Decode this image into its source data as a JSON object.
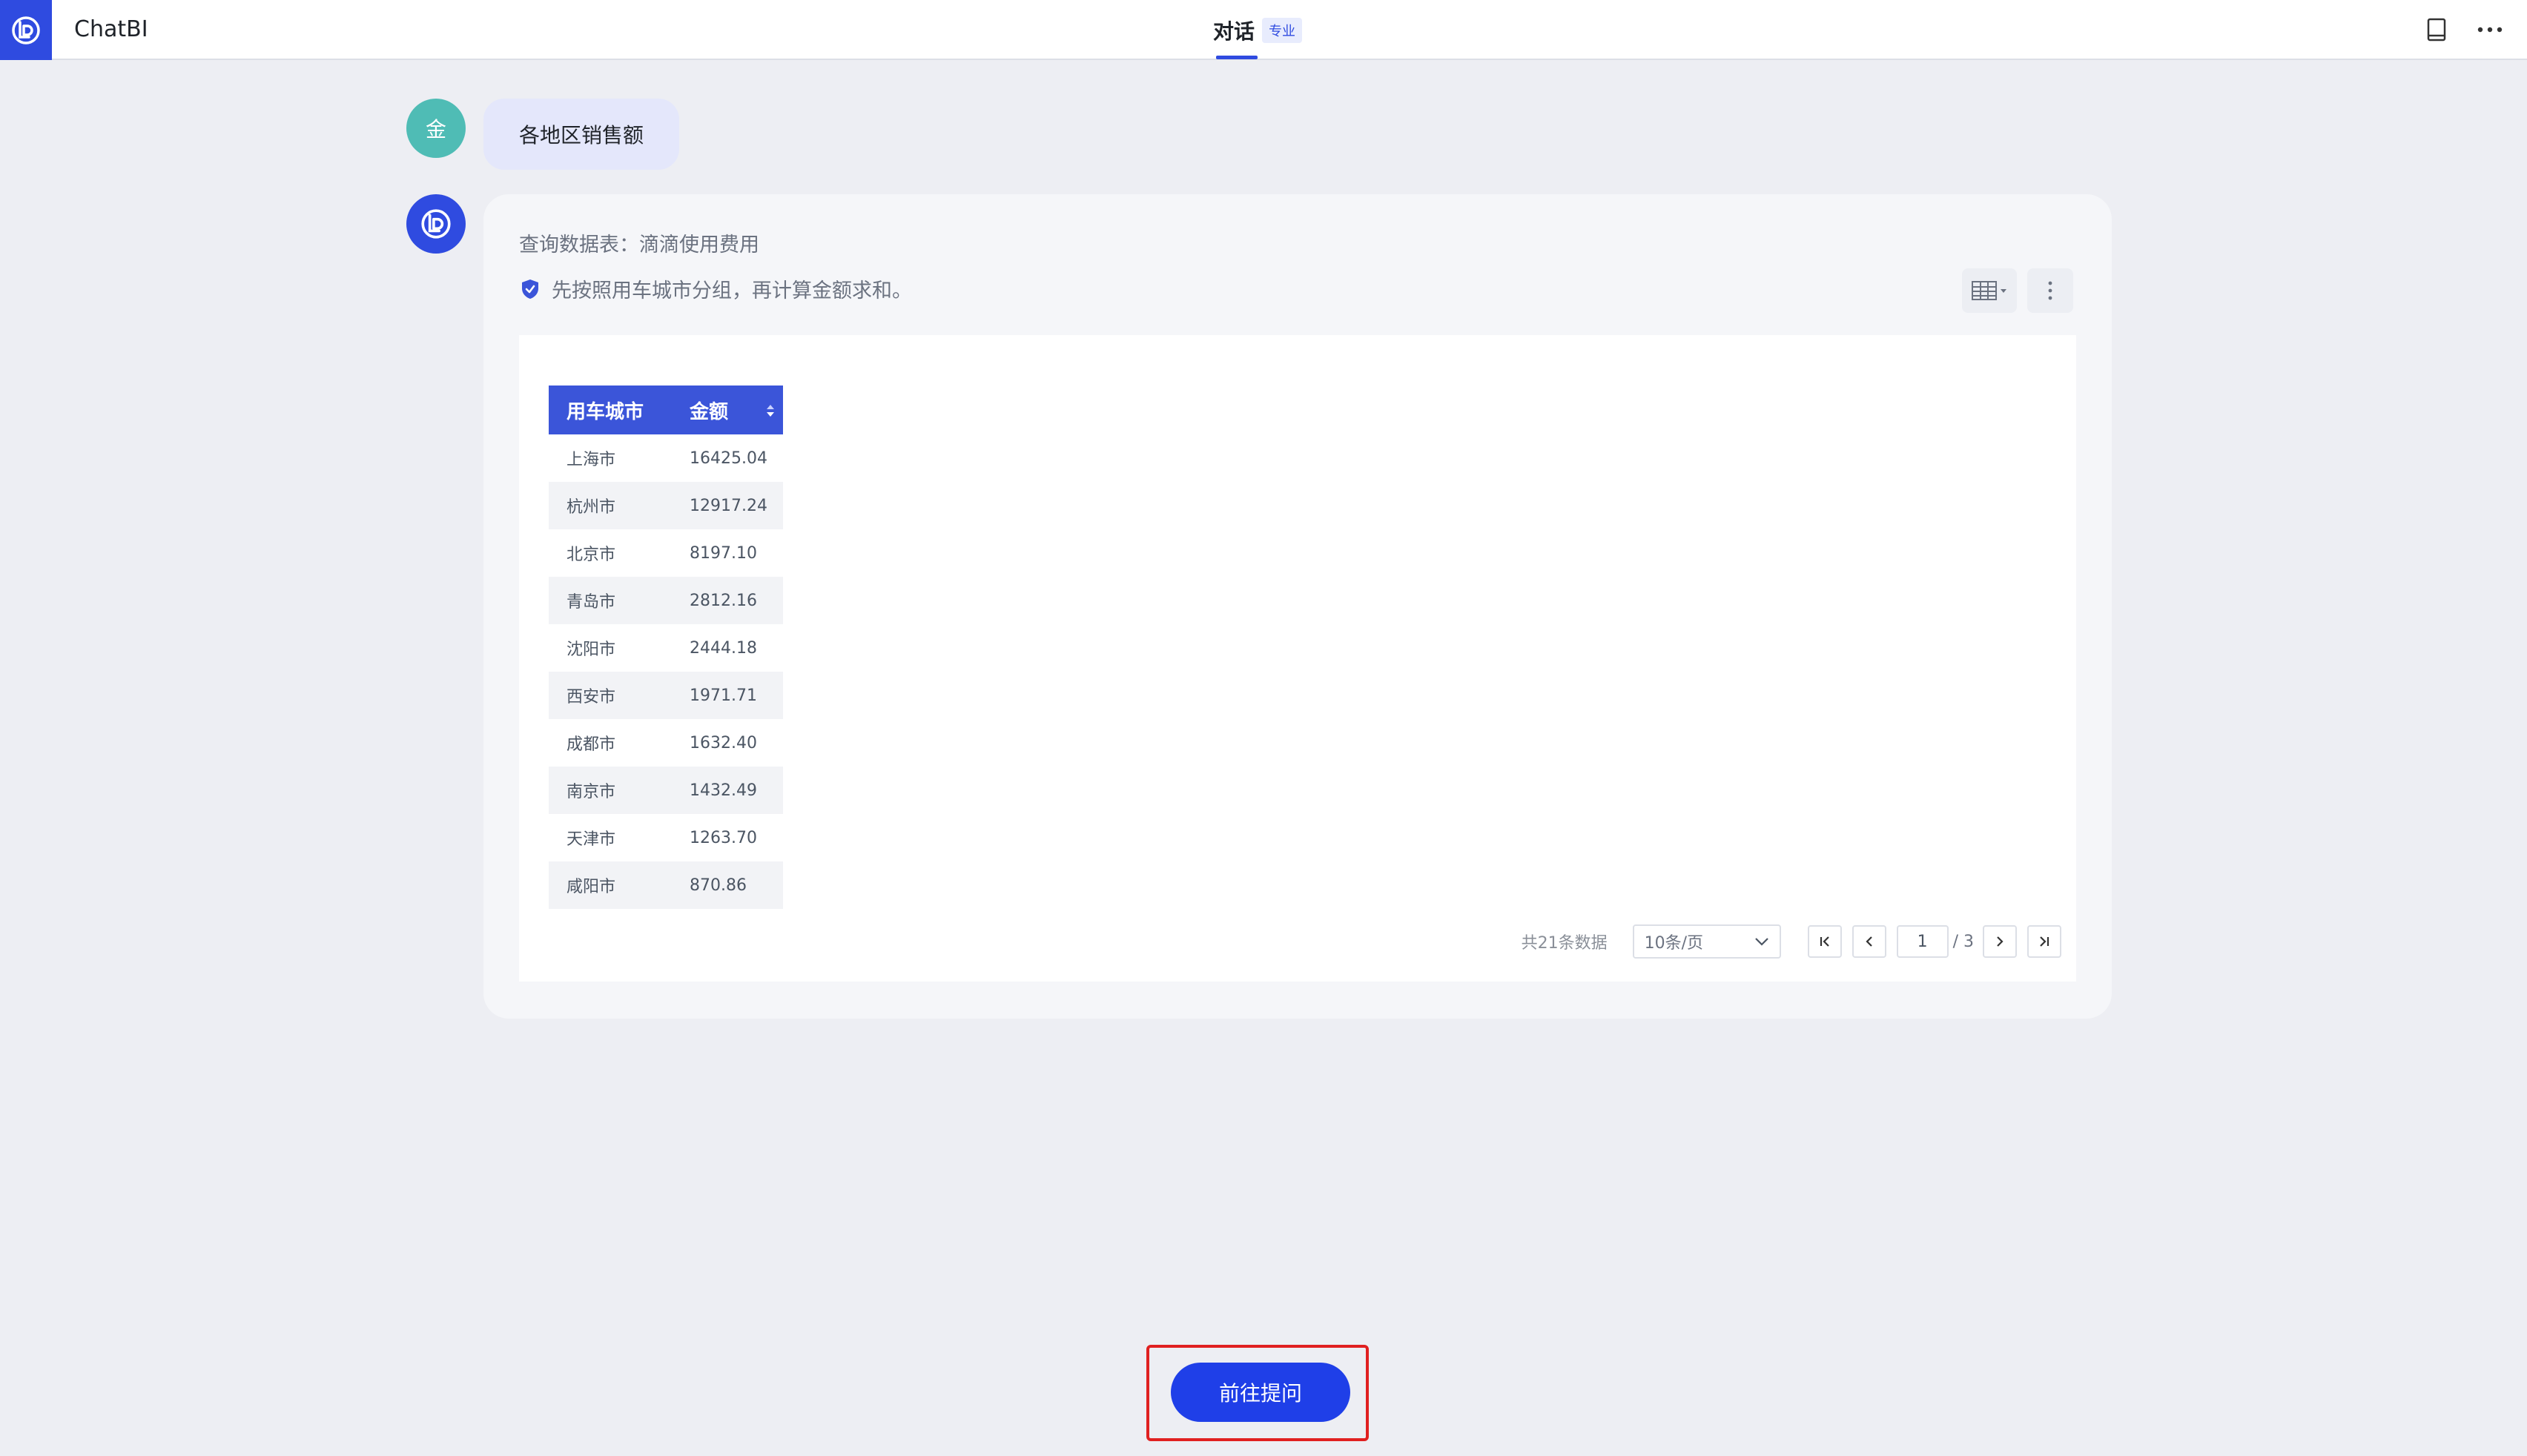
{
  "header": {
    "app_title": "ChatBI",
    "tab_label": "对话",
    "tab_badge": "专业",
    "icons": [
      "app-logo-icon",
      "book-icon",
      "more-horizontal-icon"
    ]
  },
  "conversation": {
    "user_avatar_text": "金",
    "user_message": "各地区销售额",
    "answer": {
      "query_line": "查询数据表：滴滴使用费用",
      "step_line": "先按照用车城市分组，再计算金额求和。",
      "table": {
        "columns": [
          "用车城市",
          "金额"
        ],
        "rows": [
          [
            "上海市",
            "16425.04"
          ],
          [
            "杭州市",
            "12917.24"
          ],
          [
            "北京市",
            "8197.10"
          ],
          [
            "青岛市",
            "2812.16"
          ],
          [
            "沈阳市",
            "2444.18"
          ],
          [
            "西安市",
            "1971.71"
          ],
          [
            "成都市",
            "1632.40"
          ],
          [
            "南京市",
            "1432.49"
          ],
          [
            "天津市",
            "1263.70"
          ],
          [
            "咸阳市",
            "870.86"
          ]
        ]
      },
      "pagination": {
        "total_text": "共21条数据",
        "page_size": "10条/页",
        "current_page": "1",
        "of_pages": "/ 3"
      }
    }
  },
  "cta": {
    "label": "前往提问"
  },
  "colors": {
    "accent": "#2f4be0",
    "table_header": "#3b55d9",
    "highlight": "#e02020",
    "background": "#edeef3"
  }
}
